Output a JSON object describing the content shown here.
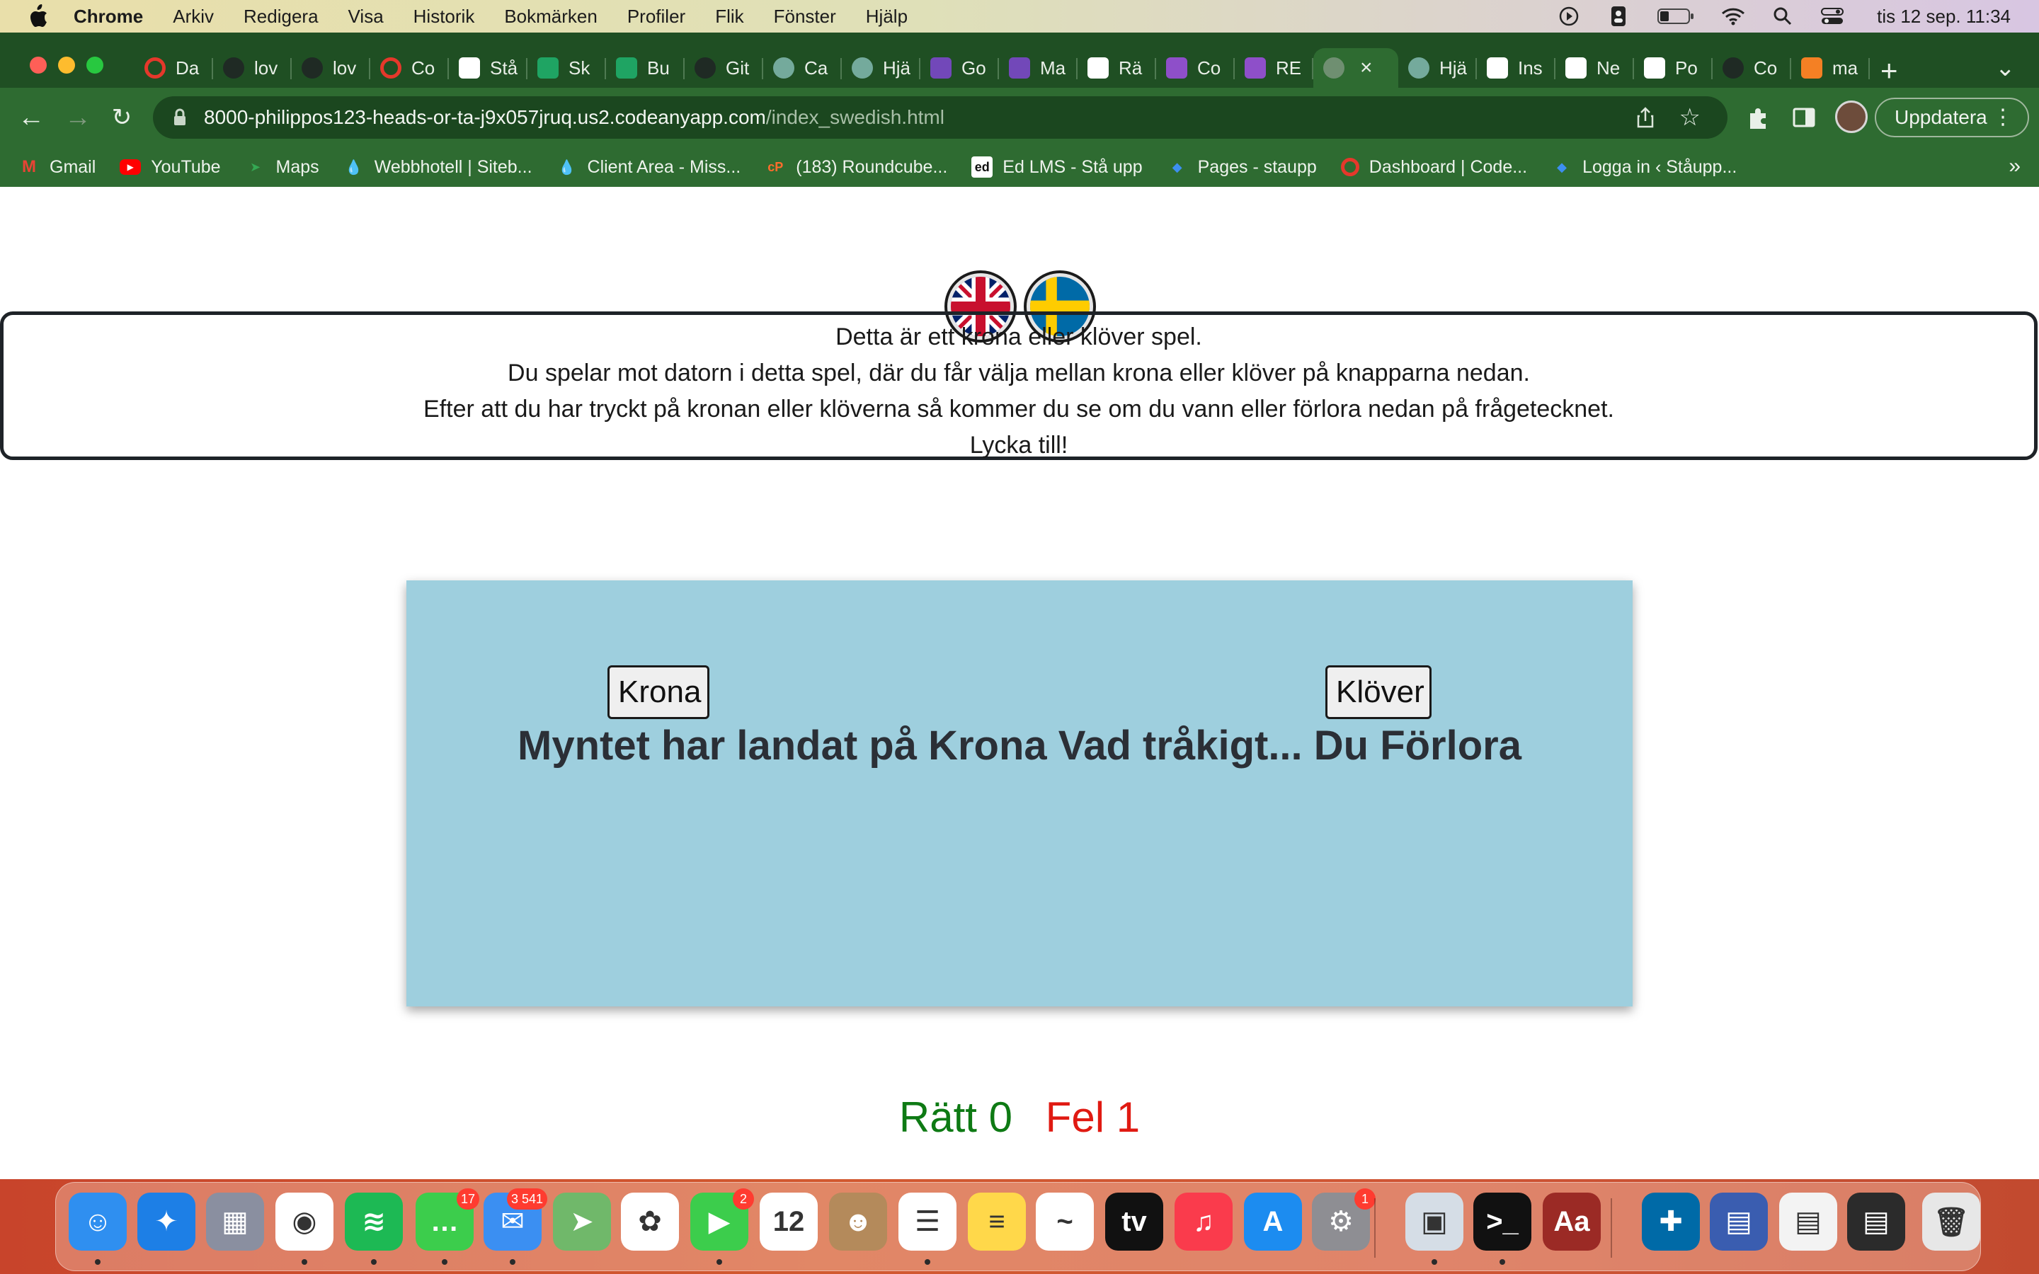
{
  "menubar": {
    "app_name": "Chrome",
    "menus": [
      "Arkiv",
      "Redigera",
      "Visa",
      "Historik",
      "Bokmärken",
      "Profiler",
      "Flik",
      "Fönster",
      "Hjälp"
    ],
    "clock": "tis 12 sep. 11:34"
  },
  "browser": {
    "tabs": [
      {
        "label": "Da",
        "icon": "opera-icon",
        "color": "#e5382b"
      },
      {
        "label": "lov",
        "icon": "github-icon",
        "color": "#1f2a24"
      },
      {
        "label": "lov",
        "icon": "github-icon",
        "color": "#1f2a24"
      },
      {
        "label": "Co",
        "icon": "opera-icon",
        "color": "#e5382b"
      },
      {
        "label": "Stå",
        "icon": "gmail-icon",
        "color": "#ffffff"
      },
      {
        "label": "Sk",
        "icon": "sheets-icon",
        "color": "#1fa463"
      },
      {
        "label": "Bu",
        "icon": "sheets-icon",
        "color": "#1fa463"
      },
      {
        "label": "Git",
        "icon": "github-icon",
        "color": "#1f2a24"
      },
      {
        "label": "Ca",
        "icon": "chatgpt-icon",
        "color": "#74aa9c"
      },
      {
        "label": "Hjä",
        "icon": "chatgpt-icon",
        "color": "#74aa9c"
      },
      {
        "label": "Go",
        "icon": "forms-icon",
        "color": "#7248b9"
      },
      {
        "label": "Ma",
        "icon": "forms-icon",
        "color": "#7248b9"
      },
      {
        "label": "Rä",
        "icon": "notion-icon",
        "color": "#ffffff"
      },
      {
        "label": "Co",
        "icon": "cube-icon",
        "color": "#8e4fc9"
      },
      {
        "label": "RE",
        "icon": "cube-icon",
        "color": "#8e4fc9"
      },
      {
        "label": "",
        "icon": "globe-icon",
        "color": "#6f8f71",
        "active": true
      },
      {
        "label": "Hjä",
        "icon": "chatgpt-icon",
        "color": "#74aa9c"
      },
      {
        "label": "Ins",
        "icon": "gear-icon",
        "color": "#ffffff"
      },
      {
        "label": "Ne",
        "icon": "download-icon",
        "color": "#ffffff"
      },
      {
        "label": "Po",
        "icon": "gmail-icon",
        "color": "#ffffff"
      },
      {
        "label": "Co",
        "icon": "github-icon",
        "color": "#1f2a24"
      },
      {
        "label": "ma",
        "icon": "stackoverflow-icon",
        "color": "#f48024"
      }
    ],
    "new_tab": "+",
    "url_host": "8000-philippos123-heads-or-ta-j9x057jruq.us2.codeanyapp.com",
    "url_path": "/index_swedish.html",
    "update_label": "Uppdatera",
    "bookmarks": [
      {
        "label": "Gmail",
        "icon": "gmail-icon"
      },
      {
        "label": "YouTube",
        "icon": "youtube-icon"
      },
      {
        "label": "Maps",
        "icon": "maps-icon"
      },
      {
        "label": "Webbhotell | Siteb...",
        "icon": "drop-icon"
      },
      {
        "label": "Client Area - Miss...",
        "icon": "drop-icon"
      },
      {
        "label": "(183) Roundcube...",
        "icon": "cpanel-icon"
      },
      {
        "label": "Ed LMS - Stå upp",
        "icon": "ed-icon"
      },
      {
        "label": "Pages - staupp",
        "icon": "diamond-icon"
      },
      {
        "label": "Dashboard | Code...",
        "icon": "opera-icon"
      },
      {
        "label": "Logga in ‹ Ståupp...",
        "icon": "diamond-icon"
      }
    ],
    "bookmarks_more": "»"
  },
  "page": {
    "intro_lines": [
      "Detta är ett krona eller klöver spel.",
      "Du spelar mot datorn i detta spel, där du får välja mellan krona eller klöver på knapparna nedan.",
      "Efter att du har tryckt på kronan eller klöverna så kommer du se om du vann eller förlora nedan på frågetecknet.",
      "Lycka till!"
    ],
    "krona_label": "Krona",
    "klover_label": "Klöver",
    "result_text": "Myntet har landat på Krona Vad tråkigt... Du Förlora",
    "score_right_label": "Rätt 0",
    "score_wrong_label": "Fel 1",
    "colors": {
      "game_bg": "#9ecfde",
      "right": "#0e7a14",
      "wrong": "#e01a12"
    }
  },
  "dock": {
    "items": [
      {
        "name": "finder-icon",
        "color": "#2f8ff0",
        "glyph": "☺"
      },
      {
        "name": "safari-icon",
        "color": "#1d7fe6",
        "glyph": "✦"
      },
      {
        "name": "launchpad-icon",
        "color": "#8a8fa0",
        "glyph": "▦"
      },
      {
        "name": "chrome-icon",
        "color": "#ffffff",
        "glyph": "◉"
      },
      {
        "name": "spotify-icon",
        "color": "#1db954",
        "glyph": "≋"
      },
      {
        "name": "messages-icon",
        "color": "#3ccd4c",
        "glyph": "…",
        "badge": "17"
      },
      {
        "name": "mail-icon",
        "color": "#3b8ff2",
        "glyph": "✉",
        "badge": "3 541"
      },
      {
        "name": "maps-icon",
        "color": "#70b86a",
        "glyph": "➤"
      },
      {
        "name": "photos-icon",
        "color": "#ffffff",
        "glyph": "✿"
      },
      {
        "name": "facetime-icon",
        "color": "#3ccd4c",
        "glyph": "▶",
        "badge": "2"
      },
      {
        "name": "calendar-icon",
        "color": "#ffffff",
        "glyph": "12"
      },
      {
        "name": "contacts-icon",
        "color": "#b48a5b",
        "glyph": "☻"
      },
      {
        "name": "reminders-icon",
        "color": "#ffffff",
        "glyph": "☰"
      },
      {
        "name": "notes-icon",
        "color": "#ffd84a",
        "glyph": "≡"
      },
      {
        "name": "freeform-icon",
        "color": "#ffffff",
        "glyph": "~"
      },
      {
        "name": "appletv-icon",
        "color": "#111111",
        "glyph": "tv"
      },
      {
        "name": "music-icon",
        "color": "#fa3b4c",
        "glyph": "♫"
      },
      {
        "name": "appstore-icon",
        "color": "#1c8cf0",
        "glyph": "A"
      },
      {
        "name": "settings-icon",
        "color": "#8e8e93",
        "glyph": "⚙",
        "badge": "1"
      },
      {
        "name": "preview-icon",
        "color": "#d5dde6",
        "glyph": "▣"
      },
      {
        "name": "terminal-icon",
        "color": "#111111",
        "glyph": ">_"
      },
      {
        "name": "dictionary-icon",
        "color": "#9b2a25",
        "glyph": "Aa"
      },
      {
        "name": "swedish-flag-icon",
        "color": "#006aa7",
        "glyph": "✚"
      },
      {
        "name": "window-thumb-icon",
        "color": "#3a5db0",
        "glyph": "▤"
      },
      {
        "name": "window-thumb-icon",
        "color": "#f3f3f3",
        "glyph": "▤"
      },
      {
        "name": "window-thumb-icon",
        "color": "#2b2b2b",
        "glyph": "▤"
      },
      {
        "name": "trash-icon",
        "color": "#e7e7e7",
        "glyph": "🗑"
      }
    ]
  }
}
